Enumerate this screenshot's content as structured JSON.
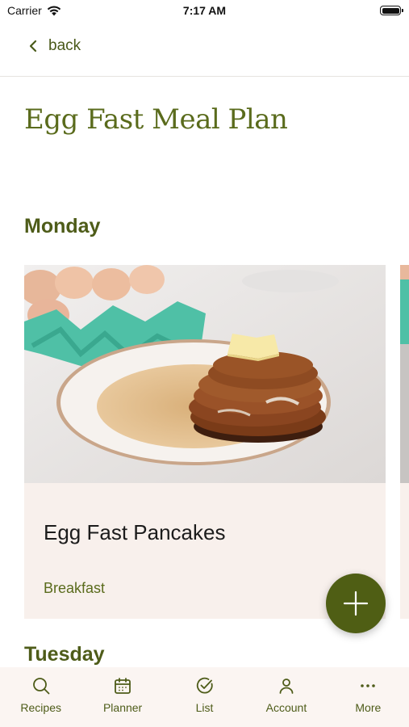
{
  "status": {
    "carrier": "Carrier",
    "time": "7:17 AM"
  },
  "nav": {
    "back_label": "back"
  },
  "page": {
    "title": "Egg Fast Meal Plan"
  },
  "days": [
    {
      "name": "Monday",
      "recipe": {
        "title": "Egg Fast Pancakes",
        "category": "Breakfast"
      }
    },
    {
      "name": "Tuesday"
    }
  ],
  "tabs": [
    {
      "label": "Recipes",
      "icon": "search-icon"
    },
    {
      "label": "Planner",
      "icon": "calendar-icon"
    },
    {
      "label": "List",
      "icon": "checkmark-circle-icon"
    },
    {
      "label": "Account",
      "icon": "person-icon"
    },
    {
      "label": "More",
      "icon": "ellipsis-icon"
    }
  ],
  "colors": {
    "accent": "#4f5e14",
    "heading": "#5a6b1c",
    "card_background": "#f8f0ec",
    "tab_bar_background": "#fbf5f2"
  }
}
